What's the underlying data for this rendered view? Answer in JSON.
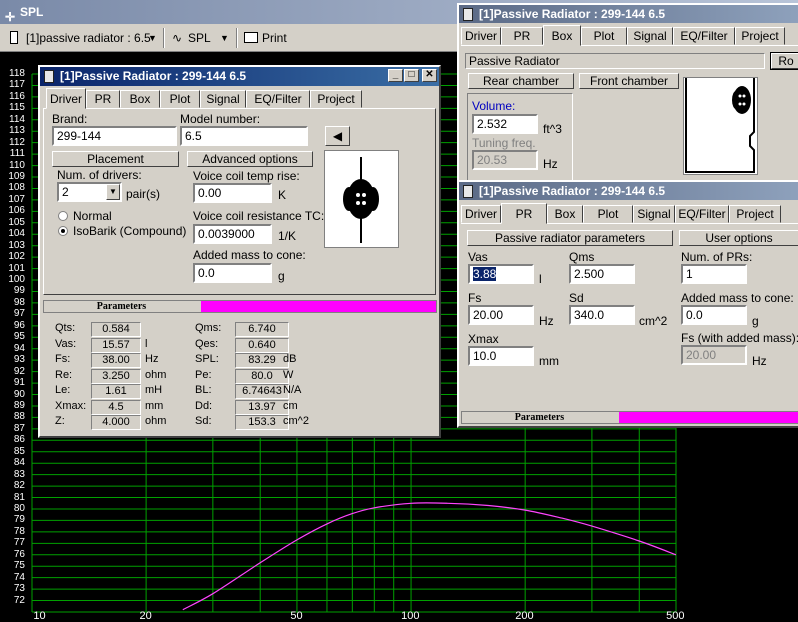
{
  "main_window": {
    "title": "SPL",
    "toolbar": {
      "project_select": "[1]passive radiator : 6.5",
      "view_select": "SPL",
      "print_label": "Print"
    }
  },
  "chart_data": {
    "type": "line",
    "x_scale": "log",
    "xlim": [
      10,
      500
    ],
    "ylim": [
      71,
      118
    ],
    "x_ticks": [
      "10",
      "20",
      "50",
      "100",
      "200",
      "500"
    ],
    "y_ticks": [
      "118",
      "117",
      "116",
      "115",
      "114",
      "113",
      "112",
      "111",
      "110",
      "109",
      "108",
      "107",
      "106",
      "105",
      "104",
      "103",
      "102",
      "101",
      "100",
      "99",
      "98",
      "97",
      "96",
      "95",
      "94",
      "93",
      "92",
      "91",
      "90",
      "89",
      "88",
      "87",
      "86",
      "85",
      "84",
      "83",
      "82",
      "81",
      "80",
      "79",
      "78",
      "77",
      "76",
      "75",
      "74",
      "73",
      "72"
    ],
    "series": [
      {
        "color": "#ff44ff",
        "x": [
          25,
          30,
          40,
          50,
          60,
          70,
          80,
          100,
          125,
          160,
          200,
          250,
          300,
          400,
          500
        ],
        "y": [
          71.2,
          72.6,
          75.3,
          77.3,
          78.7,
          79.6,
          80.1,
          80.5,
          80.5,
          80.3,
          79.9,
          79.2,
          78.5,
          77.2,
          76.0
        ]
      }
    ]
  },
  "driver_window": {
    "title": "[1]Passive Radiator : 299-144 6.5",
    "tabs": [
      "Driver",
      "PR",
      "Box",
      "Plot",
      "Signal",
      "EQ/Filter",
      "Project"
    ],
    "active_tab": "Driver",
    "brand_label": "Brand:",
    "brand_value": "299-144",
    "model_label": "Model number:",
    "model_value": "6.5",
    "placement_button": "Placement",
    "advanced_button": "Advanced options",
    "num_drivers_label": "Num. of drivers:",
    "num_drivers_value": "2",
    "pairs_unit": "pair(s)",
    "radio_normal": "Normal",
    "radio_isobarik": "IsoBarik (Compound)",
    "vc_temp_label": "Voice coil temp rise:",
    "vc_temp_value": "0.00",
    "vc_temp_unit": "K",
    "vc_tc_label": "Voice coil resistance TC:",
    "vc_tc_value": "0.0039000",
    "vc_tc_unit": "1/K",
    "added_mass_label": "Added mass to cone:",
    "added_mass_value": "0.0",
    "added_mass_unit": "g",
    "parameters_label": "Parameters",
    "params_left": [
      {
        "label": "Qts:",
        "value": "0.584",
        "unit": ""
      },
      {
        "label": "Vas:",
        "value": "15.57",
        "unit": "l"
      },
      {
        "label": "Fs:",
        "value": "38.00",
        "unit": "Hz"
      },
      {
        "label": "Re:",
        "value": "3.250",
        "unit": "ohm"
      },
      {
        "label": "Le:",
        "value": "1.61",
        "unit": "mH"
      },
      {
        "label": "Xmax:",
        "value": "4.5",
        "unit": "mm"
      },
      {
        "label": "Z:",
        "value": "4.000",
        "unit": "ohm"
      }
    ],
    "params_right": [
      {
        "label": "Qms:",
        "value": "6.740",
        "unit": ""
      },
      {
        "label": "Qes:",
        "value": "0.640",
        "unit": ""
      },
      {
        "label": "SPL:",
        "value": "83.29",
        "unit": "dB"
      },
      {
        "label": "Pe:",
        "value": "80.0",
        "unit": "W"
      },
      {
        "label": "BL:",
        "value": "6.74643",
        "unit": "N/A"
      },
      {
        "label": "Dd:",
        "value": "13.97",
        "unit": "cm"
      },
      {
        "label": "Sd:",
        "value": "153.3",
        "unit": "cm^2"
      }
    ]
  },
  "box_window": {
    "title": "[1]Passive Radiator : 299-144 6.5",
    "tabs": [
      "Driver",
      "PR",
      "Box",
      "Plot",
      "Signal",
      "EQ/Filter",
      "Project"
    ],
    "active_tab": "Box",
    "box_type": "Passive Radiator",
    "side_button": "Ro",
    "rear_chamber_button": "Rear chamber",
    "front_chamber_button": "Front chamber",
    "volume_label": "Volume:",
    "volume_value": "2.532",
    "volume_unit": "ft^3",
    "tuning_label": "Tuning freq.",
    "tuning_value": "20.53",
    "tuning_unit": "Hz"
  },
  "pr_window": {
    "title": "[1]Passive Radiator : 299-144 6.5",
    "tabs": [
      "Driver",
      "PR",
      "Box",
      "Plot",
      "Signal",
      "EQ/Filter",
      "Project"
    ],
    "active_tab": "PR",
    "pr_params_button": "Passive radiator parameters",
    "user_options_button": "User options",
    "vas_label": "Vas",
    "vas_value": "3.88",
    "vas_unit": "l",
    "qms_label": "Qms",
    "qms_value": "2.500",
    "fs_label": "Fs",
    "fs_value": "20.00",
    "fs_unit": "Hz",
    "sd_label": "Sd",
    "sd_value": "340.0",
    "sd_unit": "cm^2",
    "xmax_label": "Xmax",
    "xmax_value": "10.0",
    "xmax_unit": "mm",
    "num_pr_label": "Num. of PRs:",
    "num_pr_value": "1",
    "added_mass_label": "Added mass to cone:",
    "added_mass_value": "0.0",
    "added_mass_unit": "g",
    "fs_added_label": "Fs (with added mass):",
    "fs_added_value": "20.00",
    "fs_added_unit": "Hz",
    "parameters_label": "Parameters"
  },
  "colors": {
    "graph_bg": "#000000",
    "grid": "#00a000",
    "curve": "#ff44ff",
    "progress": "#ff00ff",
    "title_active": "#0a246a"
  }
}
